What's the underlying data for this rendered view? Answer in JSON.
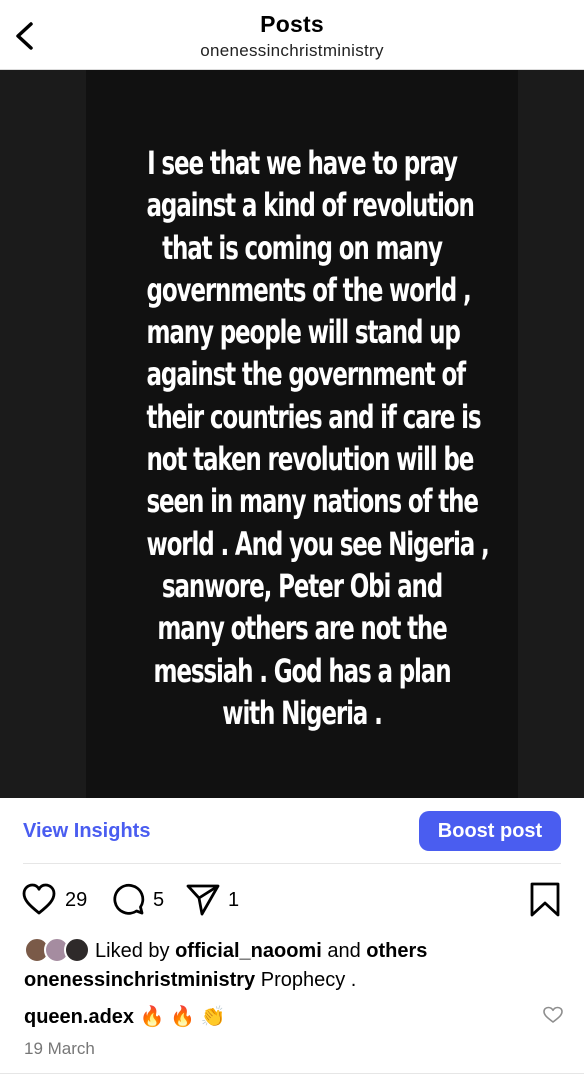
{
  "header": {
    "title": "Posts",
    "username": "onenessinchristministry"
  },
  "post": {
    "image_text_lines": [
      "I see that we have to pray",
      "against a kind of revolution",
      "that is coming on many",
      "governments of the world ,",
      "many people will stand up",
      "against the government of",
      "their countries and if care is",
      "not taken revolution will be",
      "seen in many nations of the",
      "world .  And you see Nigeria ,",
      "sanwore, Peter Obi and",
      "many others are not the",
      "messiah . God has a plan",
      "with Nigeria ."
    ]
  },
  "insights": {
    "view_label": "View Insights",
    "boost_label": "Boost post"
  },
  "actions": {
    "likes_count": "29",
    "comments_count": "5",
    "shares_count": "1"
  },
  "liked_by": {
    "prefix": "Liked by",
    "user": "official_naoomi",
    "conjunction": "and",
    "others": "others"
  },
  "caption": {
    "username": "onenessinchristministry",
    "text": "Prophecy ."
  },
  "comment": {
    "username": "queen.adex",
    "text": "🔥 🔥 👏"
  },
  "date": "19 March",
  "icons": {
    "back": "chevron-left-icon",
    "like": "heart-icon",
    "comment": "comment-bubble-icon",
    "share": "paper-plane-icon",
    "save": "bookmark-icon",
    "comment_like": "small-heart-icon"
  },
  "colors": {
    "accent": "#4a5df0",
    "media_background": "#1b1b1b"
  }
}
